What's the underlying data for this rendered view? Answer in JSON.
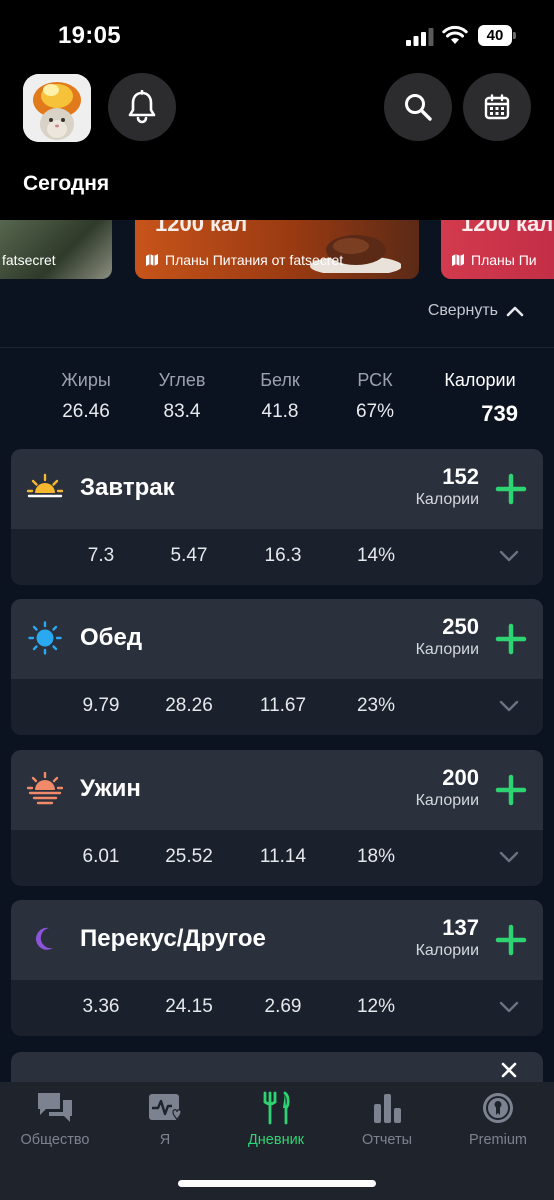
{
  "status_bar": {
    "time": "19:05",
    "battery": "40"
  },
  "header": {
    "title": "Сегодня"
  },
  "promos": [
    {
      "label": "fatsecret",
      "icon": "map-icon"
    },
    {
      "label": "Планы Питания от fatsecret",
      "top_text": "1200 кал",
      "icon": "map-icon"
    },
    {
      "label": "Планы Пи",
      "top_text": "1200 кал",
      "icon": "map-icon"
    }
  ],
  "collapse": {
    "label": "Свернуть"
  },
  "summary": {
    "fat": {
      "label": "Жиры",
      "value": "26.46"
    },
    "carbs": {
      "label": "Углев",
      "value": "83.4"
    },
    "protein": {
      "label": "Белк",
      "value": "41.8"
    },
    "rdi": {
      "label": "РСК",
      "value": "67%"
    },
    "calories": {
      "label": "Калории",
      "value": "739"
    }
  },
  "meals": [
    {
      "name": "Завтрак",
      "icon": "sunrise-icon",
      "calories": "152",
      "calories_label": "Калории",
      "fat": "7.3",
      "carbs": "5.47",
      "protein": "16.3",
      "rdi": "14%"
    },
    {
      "name": "Обед",
      "icon": "sun-icon",
      "calories": "250",
      "calories_label": "Калории",
      "fat": "9.79",
      "carbs": "28.26",
      "protein": "11.67",
      "rdi": "23%"
    },
    {
      "name": "Ужин",
      "icon": "sunset-icon",
      "calories": "200",
      "calories_label": "Калории",
      "fat": "6.01",
      "carbs": "25.52",
      "protein": "11.14",
      "rdi": "18%"
    },
    {
      "name": "Перекус/Другое",
      "icon": "moon-icon",
      "calories": "137",
      "calories_label": "Калории",
      "fat": "3.36",
      "carbs": "24.15",
      "protein": "2.69",
      "rdi": "12%"
    }
  ],
  "tabs": [
    {
      "label": "Общество",
      "icon": "chat-bubbles-icon"
    },
    {
      "label": "Я",
      "icon": "heart-pulse-icon"
    },
    {
      "label": "Дневник",
      "icon": "fork-knife-icon",
      "active": true
    },
    {
      "label": "Отчеты",
      "icon": "bar-chart-icon"
    },
    {
      "label": "Premium",
      "icon": "premium-badge-icon"
    }
  ],
  "colors": {
    "accent_green": "#2fd472",
    "card_header": "#2a303c",
    "card_body": "#1a202c",
    "background": "#0b1220"
  }
}
